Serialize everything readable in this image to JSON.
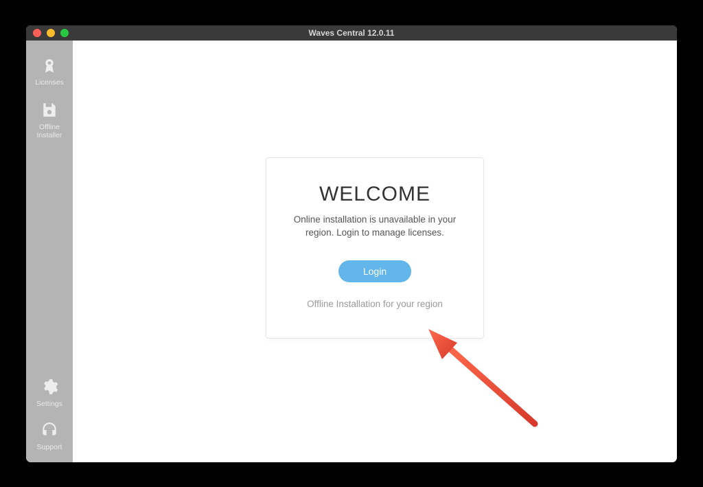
{
  "window": {
    "title": "Waves Central 12.0.11"
  },
  "sidebar": {
    "licenses": {
      "label": "Licenses"
    },
    "offline": {
      "label": "Offline\nInstaller"
    },
    "settings": {
      "label": "Settings"
    },
    "support": {
      "label": "Support"
    }
  },
  "card": {
    "heading": "WELCOME",
    "subtext": "Online installation is unavailable in your region. Login to manage licenses.",
    "login_label": "Login",
    "offline_link": "Offline Installation for your region"
  }
}
